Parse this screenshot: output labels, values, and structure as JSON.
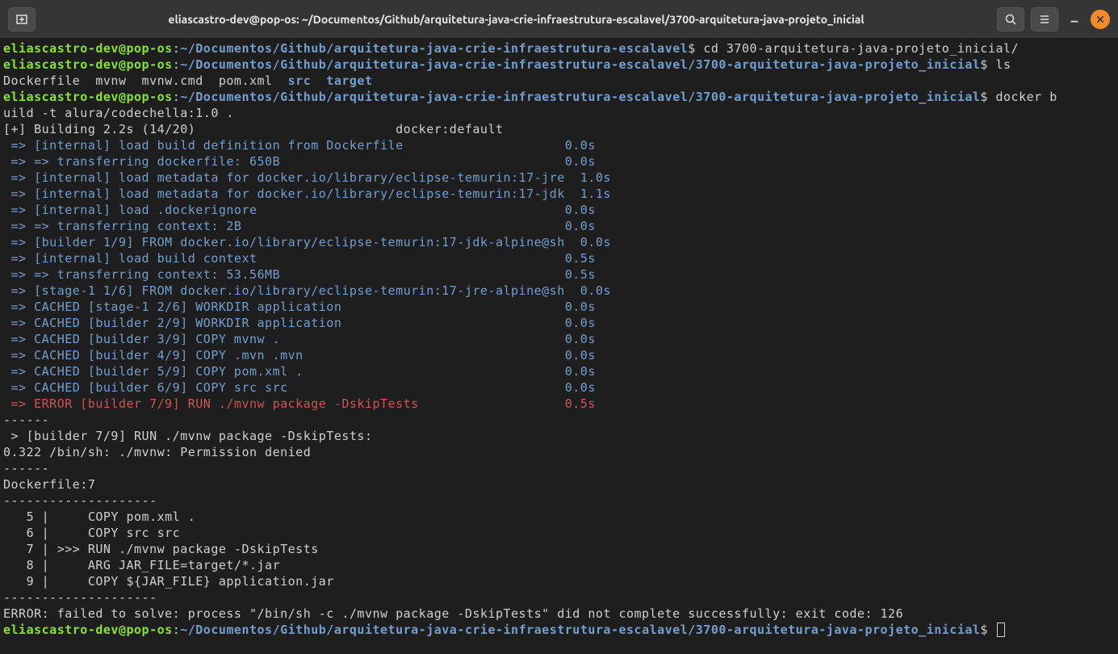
{
  "titlebar": {
    "title": "eliascastro-dev@pop-os: ~/Documentos/Github/arquitetura-java-crie-infraestrutura-escalavel/3700-arquitetura-java-projeto_inicial"
  },
  "prompts": [
    {
      "user": "eliascastro-dev@pop-os",
      "path": "~/Documentos/Github/arquitetura-java-crie-infraestrutura-escalavel",
      "cmd": "cd 3700-arquitetura-java-projeto_inicial/"
    },
    {
      "user": "eliascastro-dev@pop-os",
      "path": "~/Documentos/Github/arquitetura-java-crie-infraestrutura-escalavel/3700-arquitetura-java-projeto_inicial",
      "cmd": "ls"
    },
    {
      "user": "eliascastro-dev@pop-os",
      "path": "~/Documentos/Github/arquitetura-java-crie-infraestrutura-escalavel/3700-arquitetura-java-projeto_inicial",
      "cmd": "docker b"
    },
    {
      "user": "eliascastro-dev@pop-os",
      "path": "~/Documentos/Github/arquitetura-java-crie-infraestrutura-escalavel/3700-arquitetura-java-projeto_inicial",
      "cmd": ""
    }
  ],
  "ls_output": {
    "files": "Dockerfile  mvnw  mvnw.cmd  pom.xml  ",
    "dir1": "src",
    "dir2": "target"
  },
  "docker_cmd_cont": "uild -t alura/codechella:1.0 .",
  "build_header": "[+] Building 2.2s (14/20)                          docker:default",
  "build_lines": [
    {
      "text": " => [internal] load build definition from Dockerfile                     ",
      "time": "0.0s"
    },
    {
      "text": " => => transferring dockerfile: 650B                                     ",
      "time": "0.0s"
    },
    {
      "text": " => [internal] load metadata for docker.io/library/eclipse-temurin:17-jre",
      "time": "  1.0s"
    },
    {
      "text": " => [internal] load metadata for docker.io/library/eclipse-temurin:17-jdk",
      "time": "  1.1s"
    },
    {
      "text": " => [internal] load .dockerignore                                        ",
      "time": "0.0s"
    },
    {
      "text": " => => transferring context: 2B                                          ",
      "time": "0.0s"
    },
    {
      "text": " => [builder 1/9] FROM docker.io/library/eclipse-temurin:17-jdk-alpine@sh",
      "time": "  0.0s"
    },
    {
      "text": " => [internal] load build context                                        ",
      "time": "0.5s"
    },
    {
      "text": " => => transferring context: 53.56MB                                     ",
      "time": "0.5s"
    },
    {
      "text": " => [stage-1 1/6] FROM docker.io/library/eclipse-temurin:17-jre-alpine@sh",
      "time": "  0.0s"
    },
    {
      "text": " => CACHED [stage-1 2/6] WORKDIR application                             ",
      "time": "0.0s"
    },
    {
      "text": " => CACHED [builder 2/9] WORKDIR application                             ",
      "time": "0.0s"
    },
    {
      "text": " => CACHED [builder 3/9] COPY mvnw .                                     ",
      "time": "0.0s"
    },
    {
      "text": " => CACHED [builder 4/9] COPY .mvn .mvn                                  ",
      "time": "0.0s"
    },
    {
      "text": " => CACHED [builder 5/9] COPY pom.xml .                                  ",
      "time": "0.0s"
    },
    {
      "text": " => CACHED [builder 6/9] COPY src src                                    ",
      "time": "0.0s"
    }
  ],
  "error_build": {
    "text": " => ERROR [builder 7/9] RUN ./mvnw package -DskipTests                   ",
    "time": "0.5s"
  },
  "error_section": [
    "------",
    " > [builder 7/9] RUN ./mvnw package -DskipTests:",
    "0.322 /bin/sh: ./mvnw: Permission denied",
    "------",
    "Dockerfile:7",
    "--------------------",
    "   5 |     COPY pom.xml .",
    "   6 |     COPY src src",
    "   7 | >>> RUN ./mvnw package -DskipTests",
    "   8 |     ARG JAR_FILE=target/*.jar",
    "   9 |     COPY ${JAR_FILE} application.jar",
    "--------------------",
    "ERROR: failed to solve: process \"/bin/sh -c ./mvnw package -DskipTests\" did not complete successfully: exit code: 126"
  ]
}
